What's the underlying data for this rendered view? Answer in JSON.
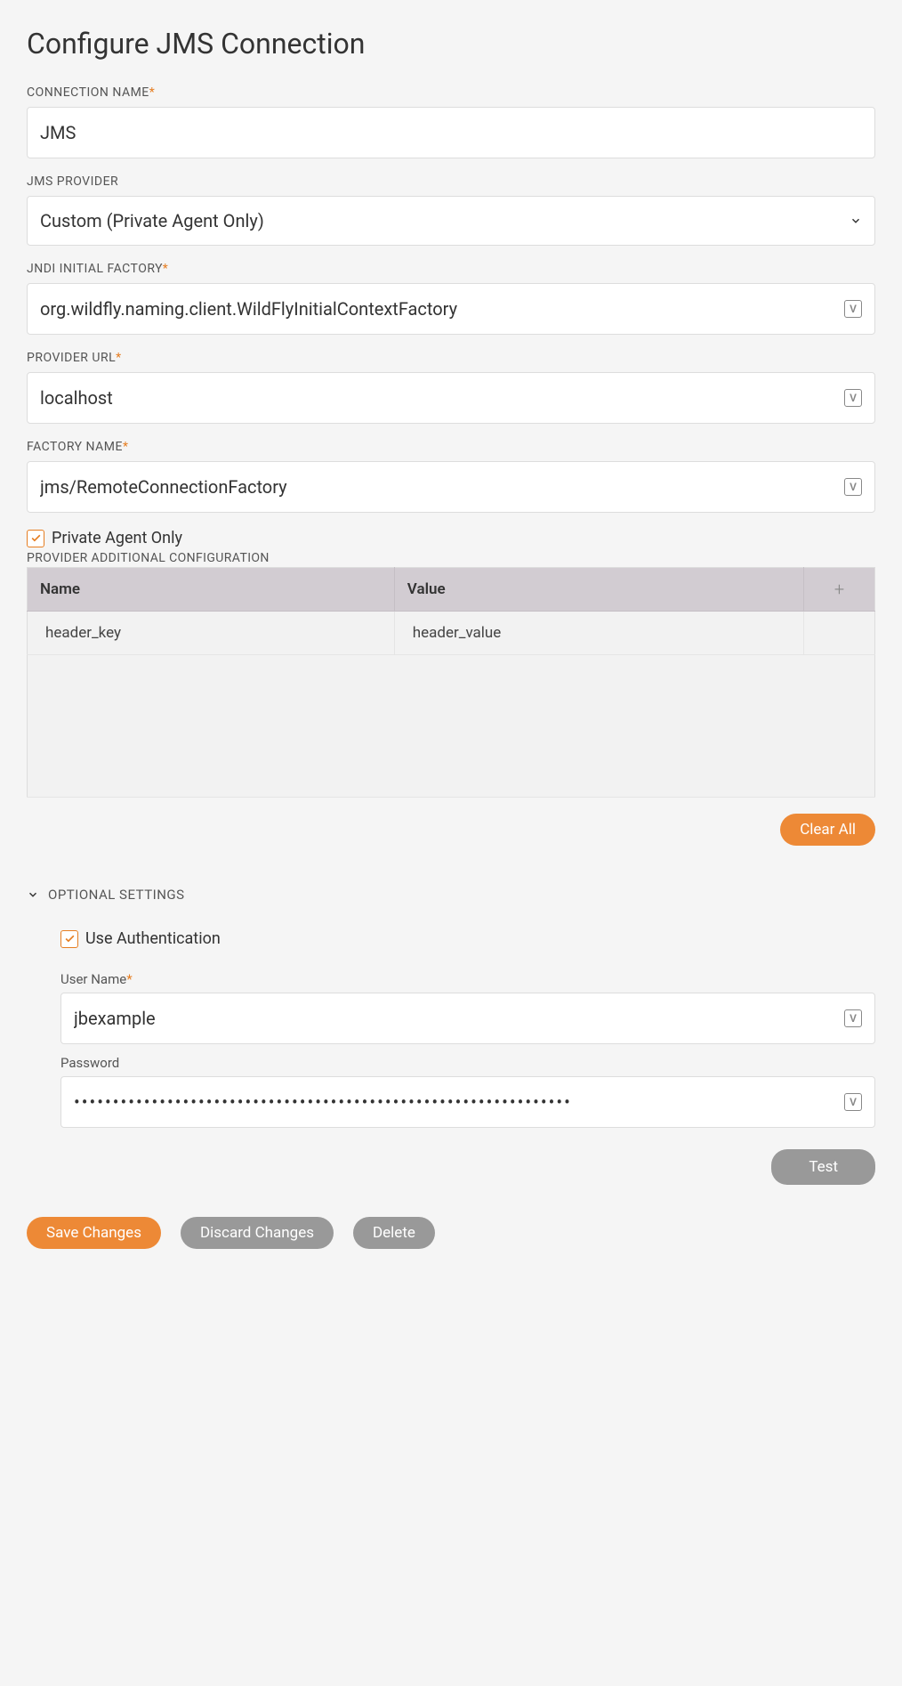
{
  "title": "Configure JMS Connection",
  "fields": {
    "connectionName": {
      "label": "CONNECTION NAME",
      "required": true,
      "value": "JMS"
    },
    "jmsProvider": {
      "label": "JMS PROVIDER",
      "required": false,
      "value": "Custom (Private Agent Only)"
    },
    "jndiFactory": {
      "label": "JNDI INITIAL FACTORY",
      "required": true,
      "value": "org.wildfly.naming.client.WildFlyInitialContextFactory"
    },
    "providerUrl": {
      "label": "PROVIDER URL",
      "required": true,
      "value": "localhost"
    },
    "factoryName": {
      "label": "FACTORY NAME",
      "required": true,
      "value": "jms/RemoteConnectionFactory"
    }
  },
  "privateAgent": {
    "label": "Private Agent Only",
    "checked": true
  },
  "providerTable": {
    "caption": "PROVIDER ADDITIONAL CONFIGURATION",
    "headers": {
      "name": "Name",
      "value": "Value"
    },
    "rows": [
      {
        "name": "header_key",
        "value": "header_value"
      }
    ]
  },
  "buttons": {
    "clearAll": "Clear All",
    "test": "Test",
    "save": "Save Changes",
    "discard": "Discard Changes",
    "delete": "Delete"
  },
  "optional": {
    "heading": "OPTIONAL SETTINGS",
    "useAuth": {
      "label": "Use Authentication",
      "checked": true
    },
    "username": {
      "label": "User Name",
      "required": true,
      "value": "jbexample"
    },
    "password": {
      "label": "Password",
      "required": false,
      "value": "••••••••••••••••••••••••••••••••••••••••••••••••••••••••••••••••"
    }
  },
  "icons": {
    "variable": "V"
  }
}
